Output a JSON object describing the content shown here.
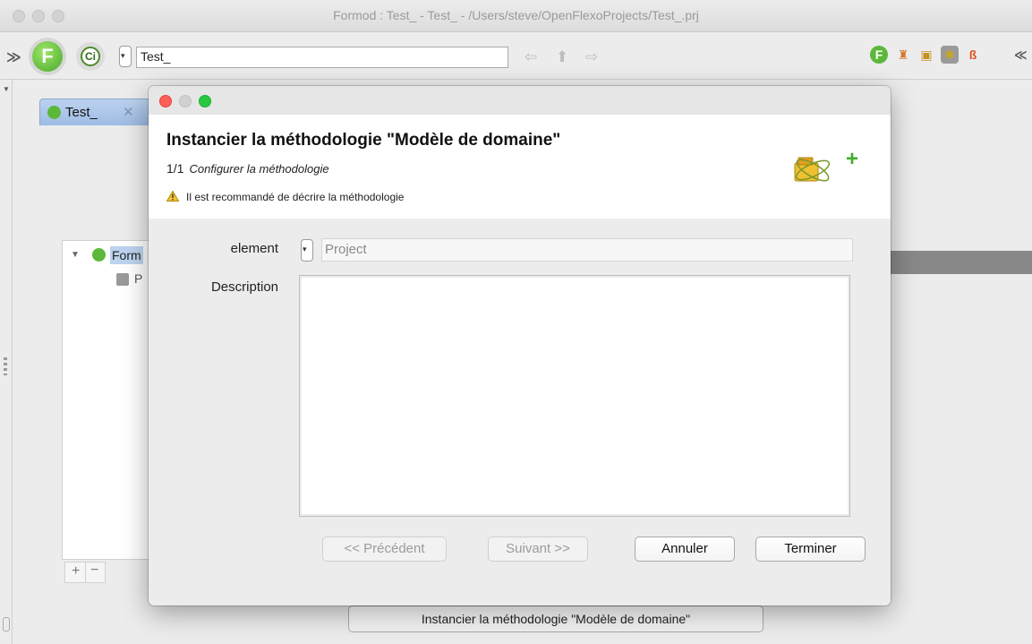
{
  "window": {
    "title": "Formod : Test_ - Test_ - /Users/steve/OpenFlexoProjects/Test_.prj"
  },
  "toolbar": {
    "project_value": "Test_"
  },
  "editor": {
    "tab_label": "Test_",
    "tree_root": "Form",
    "tree_child": "P",
    "bottom_button": "Instancier la méthodologie \"Modèle de domaine\""
  },
  "dialog": {
    "title": "Instancier la méthodologie \"Modèle de domaine\"",
    "step": "1/1",
    "subtitle": "Configurer la méthodologie",
    "warning": "Il est recommandé de décrire la méthodologie",
    "element_label": "element",
    "element_value": "Project",
    "description_label": "Description",
    "description_value": "",
    "buttons": {
      "previous": "<< Précédent",
      "next": "Suivant >>",
      "cancel": "Annuler",
      "finish": "Terminer"
    }
  },
  "colors": {
    "tab_blue": "#9dbbe4",
    "close": "#fe5f57",
    "minimize": "#c9c9c9",
    "zoom": "#2ac840"
  }
}
